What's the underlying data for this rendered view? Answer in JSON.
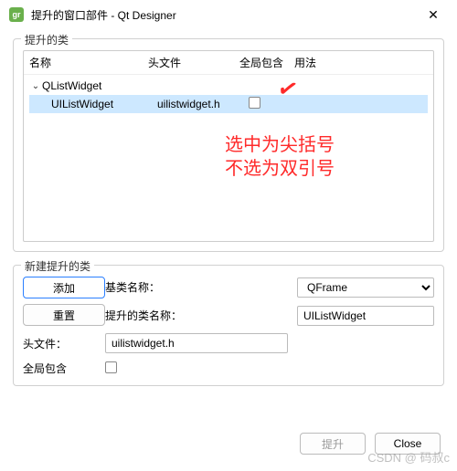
{
  "window": {
    "title": "提升的窗口部件 - Qt Designer"
  },
  "promotedGroup": {
    "title": "提升的类",
    "columns": {
      "name": "名称",
      "header": "头文件",
      "global": "全局包含",
      "usage": "用法"
    },
    "rows": {
      "parent": "QListWidget",
      "childName": "UIListWidget",
      "childHeader": "uilistwidget.h"
    }
  },
  "annotation": {
    "line1": "选中为尖括号",
    "line2": "不选为双引号"
  },
  "newGroup": {
    "title": "新建提升的类",
    "labels": {
      "base": "基类名称：",
      "promoted": "提升的类名称：",
      "header": "头文件：",
      "global": "全局包含"
    },
    "values": {
      "base": "QFrame",
      "promoted": "UIListWidget",
      "header": "uilistwidget.h"
    },
    "buttons": {
      "add": "添加",
      "reset": "重置"
    }
  },
  "dialogButtons": {
    "promote": "提升",
    "close": "Close"
  },
  "watermark": "CSDN @ 码叔c"
}
